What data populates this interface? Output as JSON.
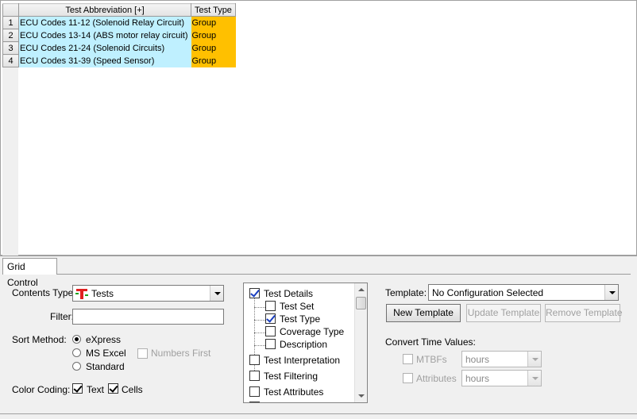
{
  "grid": {
    "columns": [
      "Test Abbreviation [+]",
      "Test Type"
    ],
    "rows": [
      {
        "num": "1",
        "abbr": "ECU Codes 11-12 (Solenoid Relay Circuit)",
        "type": "Group"
      },
      {
        "num": "2",
        "abbr": "ECU Codes 13-14 (ABS motor relay circuit)",
        "type": "Group"
      },
      {
        "num": "3",
        "abbr": "ECU Codes 21-24 (Solenoid Circuits)",
        "type": "Group"
      },
      {
        "num": "4",
        "abbr": "ECU Codes 31-39 (Speed Sensor)",
        "type": "Group"
      }
    ]
  },
  "tab": {
    "label": "Grid Control"
  },
  "contents_type": {
    "label": "Contents Type:",
    "value": "Tests",
    "icon": "tests-t-icon"
  },
  "filter": {
    "label": "Filter:",
    "value": ""
  },
  "sort_method": {
    "label": "Sort Method:",
    "options": [
      "eXpress",
      "MS Excel",
      "Standard"
    ],
    "selected": "eXpress",
    "numbers_first": {
      "label": "Numbers First",
      "checked": false,
      "enabled": false
    }
  },
  "color_coding": {
    "label": "Color Coding:",
    "text": {
      "label": "Text",
      "checked": true
    },
    "cells": {
      "label": "Cells",
      "checked": true
    }
  },
  "tree": {
    "items": [
      {
        "label": "Test Details",
        "checked": true,
        "level": 0
      },
      {
        "label": "Test Set",
        "checked": false,
        "level": 1
      },
      {
        "label": "Test Type",
        "checked": true,
        "level": 1
      },
      {
        "label": "Coverage Type",
        "checked": false,
        "level": 1
      },
      {
        "label": "Description",
        "checked": false,
        "level": 1
      },
      {
        "label": "Test Interpretation",
        "checked": false,
        "level": 0
      },
      {
        "label": "Test Filtering",
        "checked": false,
        "level": 0
      },
      {
        "label": "Test Attributes",
        "checked": false,
        "level": 0
      }
    ]
  },
  "template": {
    "label": "Template:",
    "value": "No Configuration Selected",
    "new_button": "New Template",
    "update_button": "Update Template",
    "remove_button": "Remove Template"
  },
  "convert_time": {
    "label": "Convert Time Values:",
    "mtbfs": {
      "label": "MTBFs",
      "unit": "hours",
      "checked": false
    },
    "attributes": {
      "label": "Attributes",
      "unit": "hours",
      "checked": false
    }
  },
  "colors": {
    "abbr_cell": "#bff0ff",
    "type_cell": "#ffc000",
    "check_blue": "#1a3fc0"
  }
}
